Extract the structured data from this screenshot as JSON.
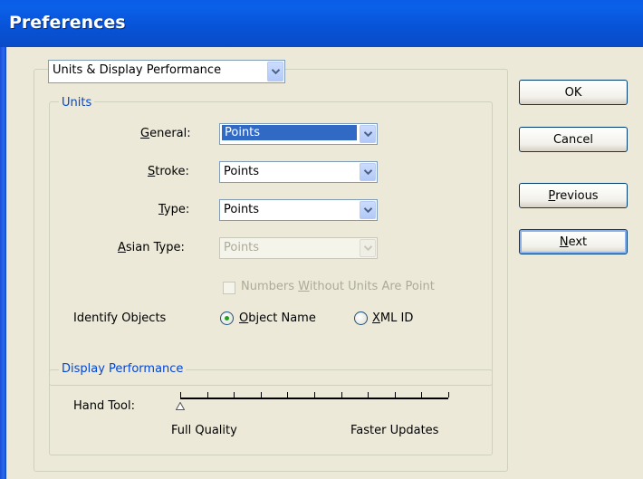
{
  "window": {
    "title": "Preferences"
  },
  "section_select": {
    "value": "Units & Display Performance"
  },
  "units": {
    "group_label": "Units",
    "general": {
      "label": "General:",
      "mnemonic": "G",
      "rest": "eneral:",
      "value": "Points"
    },
    "stroke": {
      "label": "Stroke:",
      "mnemonic": "S",
      "rest": "troke:",
      "value": "Points"
    },
    "type": {
      "label": "Type:",
      "mnemonic": "T",
      "rest": "ype:",
      "value": "Points"
    },
    "asian_type": {
      "label": "Asian Type:",
      "mnemonic": "A",
      "rest": "sian Type:",
      "value": "Points"
    },
    "numbers_without_units": {
      "pre": "Numbers ",
      "mnemonic": "W",
      "post": "ithout Units Are Point",
      "checked": false
    },
    "identify_objects": {
      "label": "Identify Objects",
      "object_name": {
        "mnemonic": "O",
        "rest": "bject Name",
        "selected": true
      },
      "xml_id": {
        "mnemonic": "X",
        "rest": "ML ID",
        "selected": false
      }
    }
  },
  "display_performance": {
    "group_label": "Display Performance",
    "hand_tool_label": "Hand Tool:",
    "slider_min_label": "Full Quality",
    "slider_max_label": "Faster Updates",
    "slider_value_fraction": 0.0
  },
  "buttons": {
    "ok": "OK",
    "cancel": "Cancel",
    "previous": {
      "mnemonic": "P",
      "rest": "revious"
    },
    "next": {
      "mnemonic": "N",
      "rest": "ext"
    }
  },
  "colors": {
    "titlebar": "#0a5de6",
    "group_label": "#0046d5",
    "selection": "#316ac5",
    "radio_dot": "#21a121"
  }
}
